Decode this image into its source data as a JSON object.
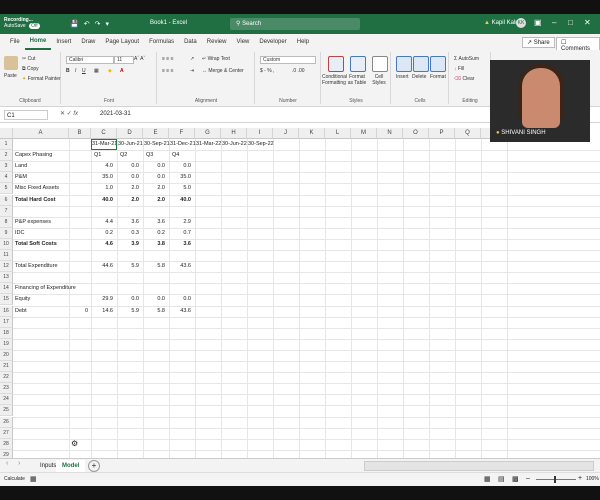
{
  "titlebar": {
    "recording_label": "Recording...",
    "autosave_label": "AutoSave",
    "autosave_state": "Off",
    "document_title": "Book1 - Excel",
    "search_placeholder": "Search",
    "user_name": "Kapil Kalra",
    "user_initials": "KK"
  },
  "menu": {
    "tabs": [
      "File",
      "Home",
      "Insert",
      "Draw",
      "Page Layout",
      "Formulas",
      "Data",
      "Review",
      "View",
      "Developer",
      "Help"
    ],
    "active_tab": "Home",
    "share_label": "Share",
    "comments_label": "Comments"
  },
  "ribbon": {
    "clipboard": {
      "caption": "Clipboard",
      "paste": "Paste",
      "cut": "Cut",
      "copy": "Copy",
      "format_painter": "Format Painter"
    },
    "font": {
      "caption": "Font",
      "font_name": "Calibri",
      "font_size": "11"
    },
    "alignment": {
      "caption": "Alignment",
      "wrap_text": "Wrap Text",
      "merge_center": "Merge & Center"
    },
    "number": {
      "caption": "Number",
      "format": "Custom"
    },
    "styles": {
      "caption": "Styles",
      "conditional": "Conditional Formatting",
      "format_table": "Format as Table",
      "cell_styles": "Cell Styles"
    },
    "cells": {
      "caption": "Cells",
      "insert": "Insert",
      "delete": "Delete",
      "format": "Format"
    },
    "editing": {
      "caption": "Editing",
      "autosum": "AutoSum",
      "fill": "Fill",
      "clear": "Clear"
    }
  },
  "formula_bar": {
    "name_box": "C1",
    "fx": "fx",
    "value": "2021-03-31"
  },
  "grid": {
    "columns": [
      "A",
      "B",
      "C",
      "D",
      "E",
      "F",
      "G",
      "H",
      "I",
      "J",
      "K",
      "L",
      "M",
      "N",
      "O",
      "P",
      "Q",
      "R"
    ],
    "row_count": 29,
    "header_row": [
      "31-Mar-21",
      "30-Jun-21",
      "30-Sep-21",
      "31-Dec-21",
      "31-Mar-22",
      "30-Jun-22",
      "30-Sep-22"
    ],
    "quarter_row": [
      "Q1",
      "Q2",
      "Q3",
      "Q4"
    ],
    "quarter_row_label": "Capex Phasing",
    "rows": [
      {
        "row": 3,
        "label": "Land",
        "values": [
          "4.0",
          "0.0",
          "0.0",
          "0.0"
        ],
        "bold": false
      },
      {
        "row": 4,
        "label": "P&M",
        "values": [
          "35.0",
          "0.0",
          "0.0",
          "35.0"
        ],
        "bold": false
      },
      {
        "row": 5,
        "label": "Misc Fixed Assets",
        "values": [
          "1.0",
          "2.0",
          "2.0",
          "5.0"
        ],
        "bold": false
      },
      {
        "row": 6,
        "label": "Total Hard Cost",
        "values": [
          "40.0",
          "2.0",
          "2.0",
          "40.0"
        ],
        "bold": true
      },
      {
        "row": 8,
        "label": "P&P expenses",
        "values": [
          "4.4",
          "3.6",
          "3.6",
          "2.9"
        ],
        "bold": false
      },
      {
        "row": 9,
        "label": "IDC",
        "values": [
          "0.2",
          "0.3",
          "0.2",
          "0.7"
        ],
        "bold": false
      },
      {
        "row": 10,
        "label": "Total Soft Costs",
        "values": [
          "4.6",
          "3.9",
          "3.8",
          "3.6"
        ],
        "bold": true
      },
      {
        "row": 12,
        "label": "Total Expenditure",
        "values": [
          "44.6",
          "5.9",
          "5.8",
          "43.6"
        ],
        "bold": false
      },
      {
        "row": 14,
        "label": "Financing of Expenditure",
        "values": [],
        "bold": false
      },
      {
        "row": 15,
        "label": "Equity",
        "values": [
          "29.9",
          "0.0",
          "0.0",
          "0.0"
        ],
        "bold": false
      },
      {
        "row": 16,
        "label": "Debt",
        "b_value": "0",
        "values": [
          "14.6",
          "5.9",
          "5.8",
          "43.6"
        ],
        "bold": false
      }
    ]
  },
  "sheets": {
    "tabs": [
      "Inputs",
      "Model"
    ],
    "active": "Model"
  },
  "status": {
    "ready": "Calculate",
    "zoom": "100%"
  },
  "video_overlay": {
    "participant_name": "SHIVANI SINGH"
  }
}
